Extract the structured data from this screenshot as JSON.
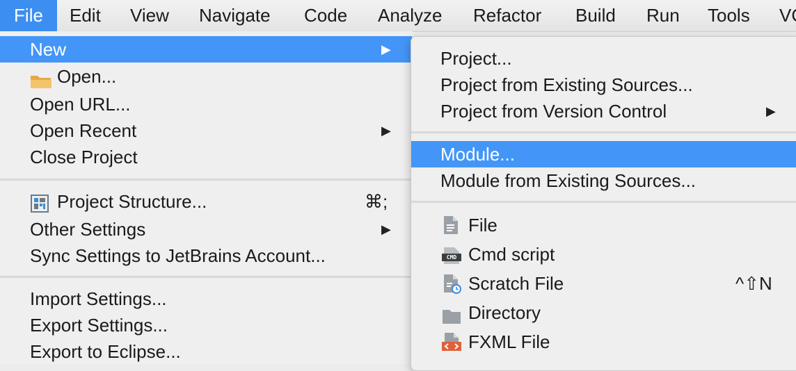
{
  "menubar": {
    "items": [
      "File",
      "Edit",
      "View",
      "Navigate",
      "Code",
      "Analyze",
      "Refactor",
      "Build",
      "Run",
      "Tools",
      "VC"
    ]
  },
  "file_menu": {
    "new": "New",
    "open": "Open...",
    "open_url": "Open URL...",
    "open_recent": "Open Recent",
    "close_project": "Close Project",
    "project_structure": "Project Structure...",
    "project_structure_shortcut": "⌘;",
    "other_settings": "Other Settings",
    "sync_settings": "Sync Settings to JetBrains Account...",
    "import_settings": "Import Settings...",
    "export_settings": "Export Settings...",
    "export_eclipse": "Export to Eclipse..."
  },
  "new_submenu": {
    "project": "Project...",
    "project_existing": "Project from Existing Sources...",
    "project_vcs": "Project from Version Control",
    "module": "Module...",
    "module_existing": "Module from Existing Sources...",
    "file": "File",
    "cmd_script": "Cmd script",
    "scratch_file": "Scratch File",
    "scratch_shortcut": "^⇧N",
    "directory": "Directory",
    "fxml_file": "FXML File",
    "cmd_icon_text": "CMD"
  },
  "colors": {
    "highlight": "#4396f7",
    "menubar_active": "#3d8ef1"
  }
}
